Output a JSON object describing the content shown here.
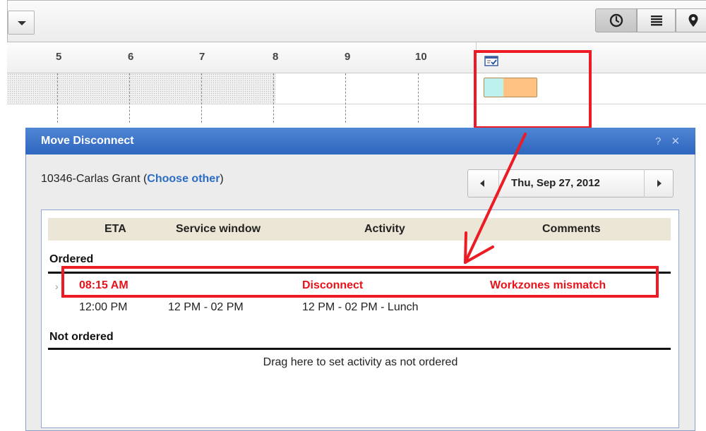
{
  "timeline": {
    "hours": [
      "5",
      "6",
      "7",
      "8",
      "9",
      "10"
    ]
  },
  "dialog": {
    "title": "Move Disconnect",
    "controls": "? ✕",
    "technician": "10346-Carlas Grant",
    "choose_open": "(",
    "choose_other_label": "Choose other",
    "choose_close": ")",
    "date": "Thu, Sep 27, 2012",
    "columns": {
      "eta": "ETA",
      "service_window": "Service window",
      "activity": "Activity",
      "comments": "Comments"
    },
    "ordered_label": "Ordered",
    "rows": [
      {
        "eta": "08:15 AM",
        "service_window": "",
        "activity": "Disconnect",
        "comments": "Workzones mismatch",
        "highlight": true
      },
      {
        "eta": "12:00 PM",
        "service_window": "12 PM - 02 PM",
        "activity": "12 PM - 02 PM - Lunch",
        "comments": "",
        "highlight": false
      }
    ],
    "not_ordered_label": "Not ordered",
    "drag_hint": "Drag here to set activity as not ordered",
    "row_marker": "›"
  },
  "icons": {
    "toolbar": [
      "chevron-down-icon",
      "clock-icon",
      "list-icon",
      "map-pin-icon"
    ],
    "calendar": "calendar-check-icon"
  },
  "colors": {
    "dialog_title_bg": "#3a72c9",
    "highlight_red": "#ec1b24",
    "activity_orange": "#ffc283",
    "activity_cyan": "#bdf1ee",
    "header_bg": "#ebe6d5",
    "link_blue": "#2b6cc4"
  }
}
